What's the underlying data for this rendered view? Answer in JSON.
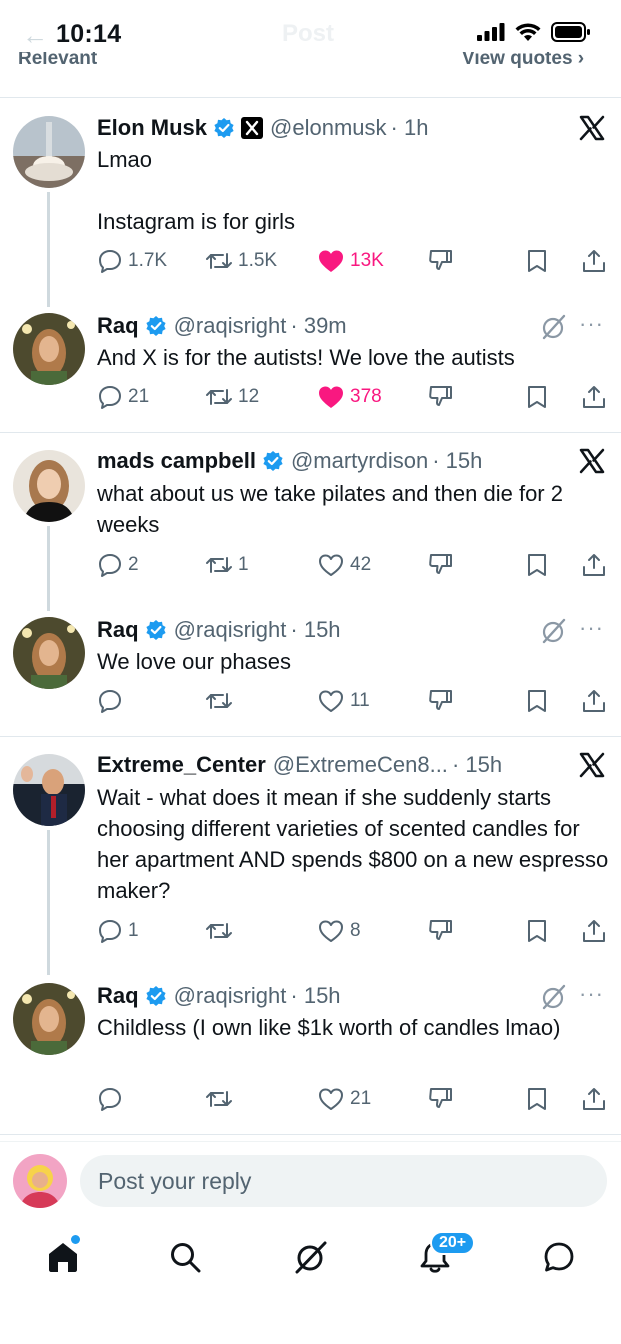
{
  "status_bar": {
    "time": "10:14"
  },
  "header": {
    "back_glyph": "←",
    "title": "Post",
    "sort_label": "Relevant",
    "quotes_label": "View quotes ›"
  },
  "verified_color": "#1d9bf0",
  "like_color": "#f91880",
  "tweets": [
    {
      "name": "Elon Musk",
      "handle": "@elonmusk",
      "time": "· 1h",
      "text": "Lmao\n\nInstagram is for girls",
      "replies": "1.7K",
      "reposts": "1.5K",
      "likes": "13K",
      "liked": true,
      "corner_icon": "x-logo-icon"
    },
    {
      "name": "Raq",
      "handle": "@raqisright",
      "time": "· 39m",
      "text": "And X is for the autists! We love the autists",
      "replies": "21",
      "reposts": "12",
      "likes": "378",
      "liked": true,
      "corner_icon": "grok-icon"
    },
    {
      "name": "mads campbell",
      "handle": "@martyrdison",
      "time": "· 15h",
      "text": "what about us we take pilates and then die for 2 weeks",
      "replies": "2",
      "reposts": "1",
      "likes": "42",
      "liked": false,
      "corner_icon": "x-logo-icon"
    },
    {
      "name": "Raq",
      "handle": "@raqisright",
      "time": "· 15h",
      "text": "We love our phases",
      "replies": "",
      "reposts": "",
      "likes": "11",
      "liked": false,
      "corner_icon": "grok-icon"
    },
    {
      "name": "Extreme_Center",
      "handle": "@ExtremeCen8...",
      "time": "· 15h",
      "text": "Wait - what does it mean if she suddenly starts choosing different varieties of scented candles for her apartment AND spends $800 on a new espresso maker?",
      "replies": "1",
      "reposts": "",
      "likes": "8",
      "liked": false,
      "corner_icon": "x-logo-icon"
    },
    {
      "name": "Raq",
      "handle": "@raqisright",
      "time": "· 15h",
      "text": "Childless (I own like $1k worth of candles lmao)",
      "replies": "",
      "reposts": "",
      "likes": "21",
      "liked": false,
      "corner_icon": "grok-icon"
    }
  ],
  "more_glyph": "···",
  "reply_bar": {
    "placeholder": "Post your reply"
  },
  "tabbar": {
    "notifications_badge": "20+"
  }
}
